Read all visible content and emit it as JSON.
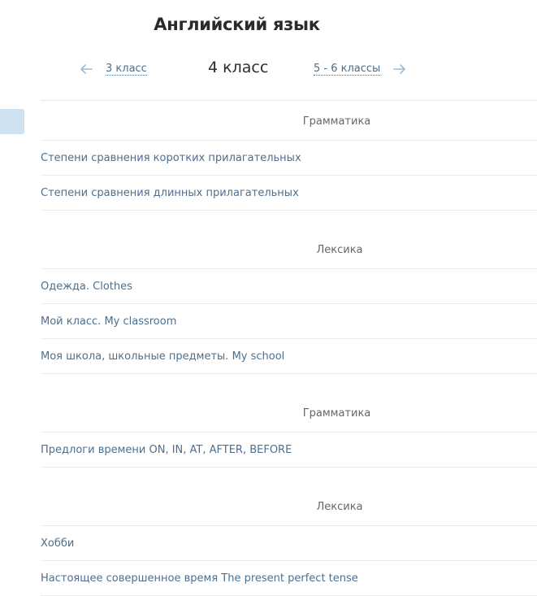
{
  "page_title": "Английский язык",
  "grade_nav": {
    "prev_label": "3 класс",
    "current_label": "4 класс",
    "next_label": "5 - 6 классы",
    "prev_icon": "arrow-left-icon",
    "next_icon": "arrow-right-icon"
  },
  "colors": {
    "link": "#4d6f8e",
    "arrow": "#9bbbd6",
    "side_tab": "#cfe0ee",
    "divider": "#ececec"
  },
  "sections": [
    {
      "title": "Грамматика",
      "items": [
        "Степени сравнения коротких прилагательных",
        "Степени сравнения длинных прилагательных"
      ]
    },
    {
      "title": "Лексика",
      "items": [
        "Одежда. Clothes",
        "Мой класс. My classroom",
        "Моя школа, школьные предметы. My school"
      ]
    },
    {
      "title": "Грамматика",
      "items": [
        "Предлоги времени ON, IN, AT, AFTER, BEFORE"
      ]
    },
    {
      "title": "Лексика",
      "items": [
        "Хобби",
        "Настоящее совершенное время The present perfect tense"
      ]
    }
  ]
}
